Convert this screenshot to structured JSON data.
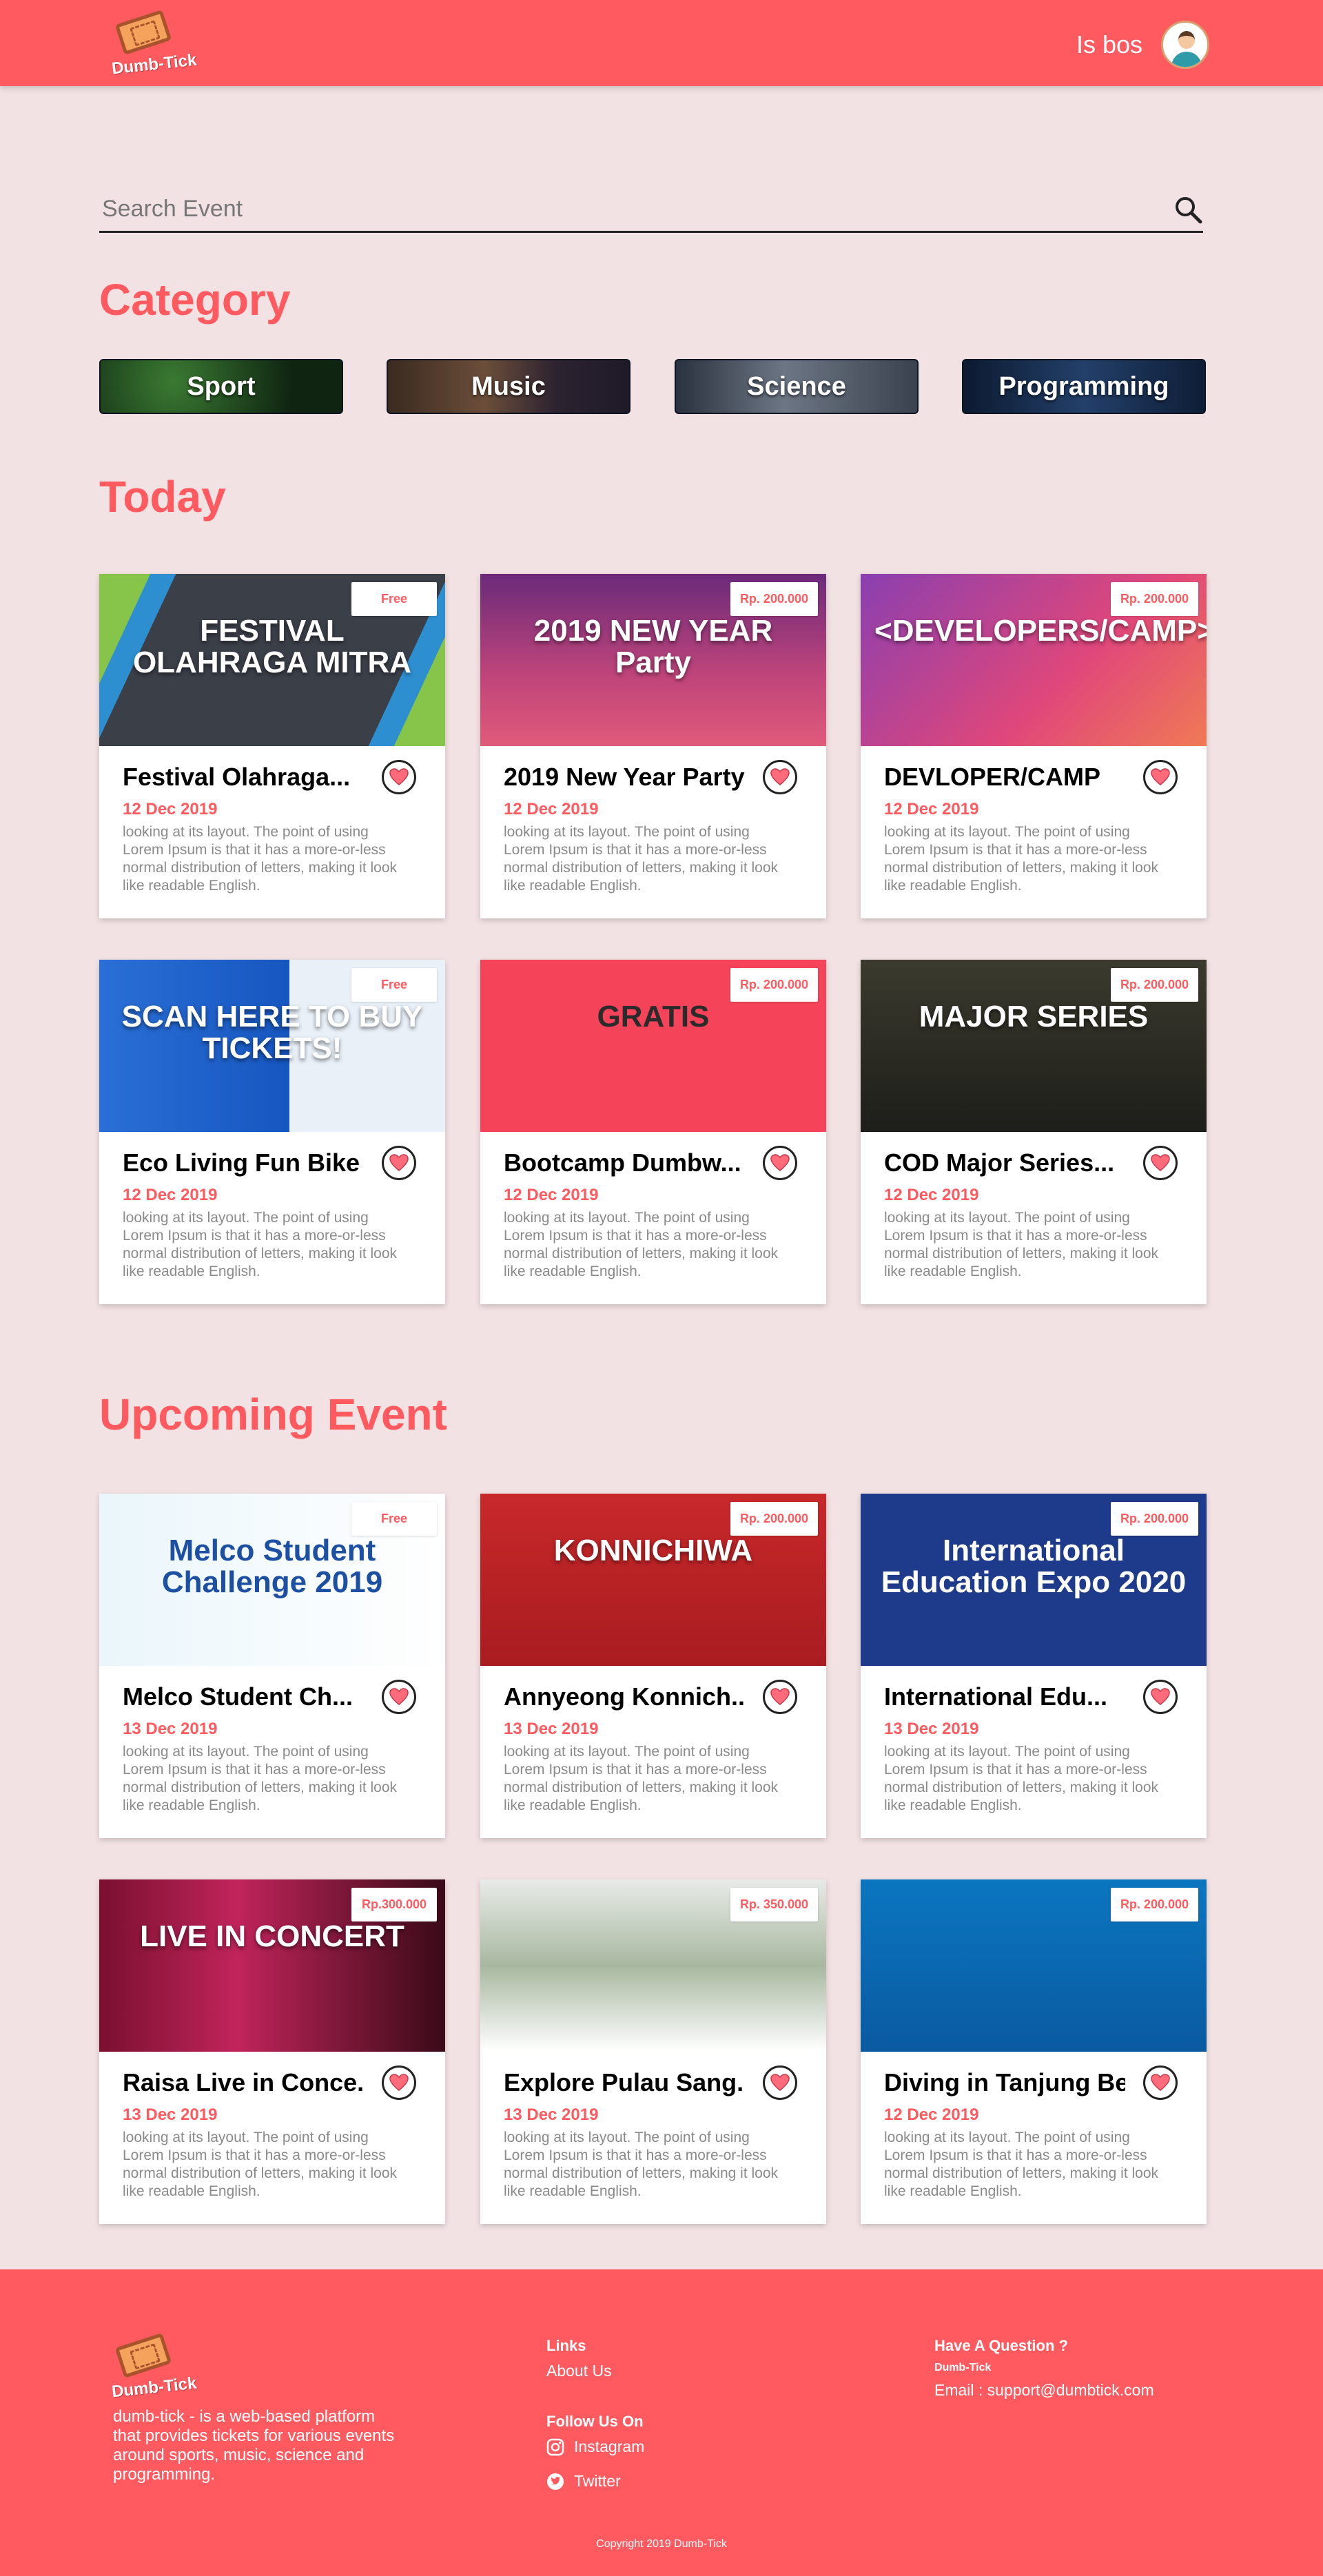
{
  "app": {
    "logo_text": "Dumb-Tick",
    "accent": "#ff5a5f"
  },
  "header": {
    "user_name": "Is bos"
  },
  "search": {
    "placeholder": "Search Event"
  },
  "categories": {
    "title": "Category",
    "items": [
      {
        "label": "Sport"
      },
      {
        "label": "Music"
      },
      {
        "label": "Science"
      },
      {
        "label": "Programming"
      }
    ]
  },
  "today": {
    "title": "Today",
    "cards": [
      {
        "title": "Festival Olahraga...",
        "date": "12 Dec 2019",
        "price": "Free",
        "image_text": "FESTIVAL OLAHRAGA MITRA",
        "desc": "looking at its layout.  The point of using Lorem Ipsum is that it has a more-or-less normal distribution of letters, making it look like readable English."
      },
      {
        "title": "2019 New Year Party",
        "date": "12 Dec 2019",
        "price": "Rp. 200.000",
        "image_text": "2019 NEW YEAR Party",
        "desc": "looking at its layout.  The point of using Lorem Ipsum is that it has a more-or-less normal distribution of letters, making it look like readable English."
      },
      {
        "title": "DEVLOPER/CAMP",
        "date": "12 Dec 2019",
        "price": "Rp. 200.000",
        "image_text": "<DEVELOPERS/CAMP>",
        "desc": "looking at its layout.  The point of using Lorem Ipsum is that it has a more-or-less normal distribution of letters, making it look like readable English."
      },
      {
        "title": "Eco Living Fun Bike",
        "date": "12 Dec 2019",
        "price": "Free",
        "image_text": "SCAN HERE TO BUY TICKETS!",
        "desc": "looking at its layout.  The point of using Lorem Ipsum is that it has a more-or-less normal distribution of letters, making it look like readable English."
      },
      {
        "title": "Bootcamp Dumbw...",
        "date": "12 Dec 2019",
        "price": "Rp. 200.000",
        "image_text": "GRATIS",
        "desc": "looking at its layout.  The point of using Lorem Ipsum is that it has a more-or-less normal distribution of letters, making it look like readable English."
      },
      {
        "title": "COD Major Series...",
        "date": "12 Dec 2019",
        "price": "Rp. 200.000",
        "image_text": "MAJOR SERIES",
        "desc": "looking at its layout.  The point of using Lorem Ipsum is that it has a more-or-less normal distribution of letters, making it look like readable English."
      }
    ]
  },
  "upcoming": {
    "title": "Upcoming Event",
    "cards": [
      {
        "title": "Melco Student Ch...",
        "date": "13 Dec 2019",
        "price": "Free",
        "image_text": "Melco Student Challenge 2019",
        "desc": "looking at its layout.  The point of using Lorem Ipsum is that it has a more-or-less normal distribution of letters, making it look like readable English."
      },
      {
        "title": "Annyeong Konnich...",
        "date": "13 Dec 2019",
        "price": "Rp. 200.000",
        "image_text": "KONNICHIWA",
        "desc": "looking at its layout.  The point of using Lorem Ipsum is that it has a more-or-less normal distribution of letters, making it look like readable English."
      },
      {
        "title": "International Edu...",
        "date": "13 Dec 2019",
        "price": "Rp. 200.000",
        "image_text": "International Education Expo 2020",
        "desc": "looking at its layout.  The point of using Lorem Ipsum is that it has a more-or-less normal distribution of letters, making it look like readable English."
      },
      {
        "title": "Raisa Live in Conce...",
        "date": "13 Dec 2019",
        "price": "Rp.300.000",
        "image_text": "LIVE IN CONCERT",
        "desc": "looking at its layout.  The point of using Lorem Ipsum is that it has a more-or-less normal distribution of letters, making it look like readable English."
      },
      {
        "title": "Explore Pulau Sang...",
        "date": "13 Dec 2019",
        "price": "Rp. 350.000",
        "image_text": "",
        "desc": "looking at its layout.  The point of using Lorem Ipsum is that it has a more-or-less normal distribution of letters, making it look like readable English."
      },
      {
        "title": "Diving in Tanjung Be..",
        "date": "12 Dec 2019",
        "price": "Rp. 200.000",
        "image_text": "",
        "desc": "looking at its layout.  The point of using Lorem Ipsum is that it has a more-or-less normal distribution of letters, making it look like readable English."
      }
    ]
  },
  "footer": {
    "about": "dumb-tick - is a web-based platform that provides tickets for various events around sports, music, science and programming.",
    "links_title": "Links",
    "about_link": "About Us",
    "follow_title": "Follow Us On",
    "instagram": "Instagram",
    "twitter": "Twitter",
    "question_title": "Have A Question ?",
    "question_brand": "Dumb-Tick",
    "email": "Email : support@dumbtick.com",
    "copyright": "Copyright 2019 Dumb-Tick"
  }
}
